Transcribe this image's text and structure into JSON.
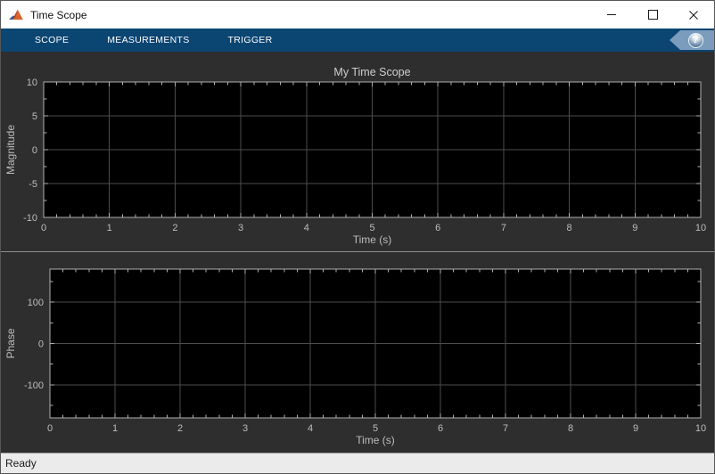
{
  "window": {
    "title": "Time Scope"
  },
  "toolstrip": {
    "tabs": [
      {
        "id": "scope",
        "label": "SCOPE"
      },
      {
        "id": "measurements",
        "label": "MEASUREMENTS"
      },
      {
        "id": "trigger",
        "label": "TRIGGER"
      }
    ],
    "help": "?"
  },
  "statusbar": {
    "text": "Ready"
  },
  "colors": {
    "toolstrip_bg": "#0b4572",
    "help_badge": "#7b9cbd",
    "panel_bg": "#2e2e2e",
    "plot_bg": "#000000",
    "grid": "#4c4c4c",
    "axis": "#b0b0b0",
    "tick_label": "#bdbdbd",
    "title_text": "#cfcfcf",
    "statusbar_bg": "#ebebeb"
  },
  "chart_data": [
    {
      "type": "line",
      "title": "My Time Scope",
      "xlabel": "Time (s)",
      "ylabel": "Magnitude",
      "xlim": [
        0,
        10
      ],
      "ylim": [
        -10,
        10
      ],
      "xticks": [
        0,
        1,
        2,
        3,
        4,
        5,
        6,
        7,
        8,
        9,
        10
      ],
      "yticks": [
        10,
        5,
        0,
        -5,
        -10
      ],
      "x_minor_step": 0.2,
      "y_minor_step": 2.5,
      "grid": true,
      "legend": "none",
      "series": []
    },
    {
      "type": "line",
      "title": "",
      "xlabel": "Time (s)",
      "ylabel": "Phase",
      "xlim": [
        0,
        10
      ],
      "ylim": [
        -180,
        180
      ],
      "xticks": [
        0,
        1,
        2,
        3,
        4,
        5,
        6,
        7,
        8,
        9,
        10
      ],
      "yticks": [
        100,
        0,
        -100
      ],
      "x_minor_step": 0.2,
      "y_minor_step": 50,
      "grid": true,
      "legend": "none",
      "series": []
    }
  ]
}
